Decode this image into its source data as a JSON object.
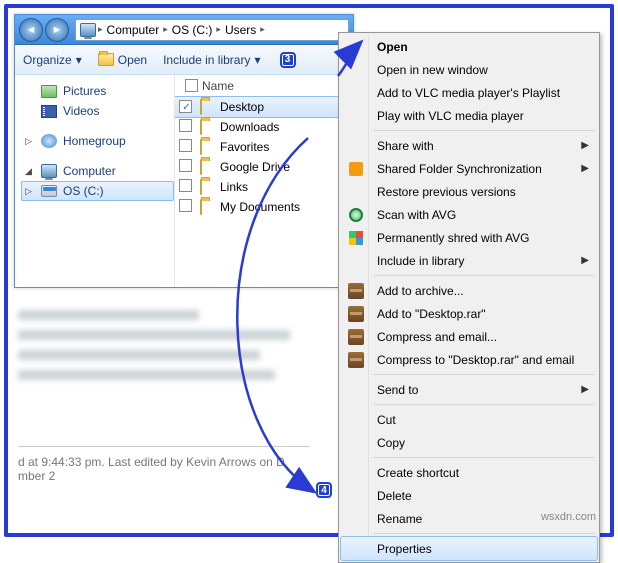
{
  "breadcrumb": {
    "root": "Computer",
    "drive": "OS (C:)",
    "folder": "Users"
  },
  "toolbar": {
    "organize": "Organize",
    "open": "Open",
    "include": "Include in library"
  },
  "badges": {
    "step3": "3",
    "step4": "4"
  },
  "nav": {
    "pictures": "Pictures",
    "videos": "Videos",
    "homegroup": "Homegroup",
    "computer": "Computer",
    "drive": "OS (C:)"
  },
  "list": {
    "header": "Name",
    "items": [
      {
        "name": "Desktop",
        "selected": true
      },
      {
        "name": "Downloads"
      },
      {
        "name": "Favorites"
      },
      {
        "name": "Google Drive"
      },
      {
        "name": "Links"
      },
      {
        "name": "My Documents"
      }
    ]
  },
  "ctx": {
    "open": "Open",
    "open_new": "Open in new window",
    "vlc_add": "Add to VLC media player's Playlist",
    "vlc_play": "Play with VLC media player",
    "share": "Share with",
    "sync": "Shared Folder Synchronization",
    "restore": "Restore previous versions",
    "avg_scan": "Scan with AVG",
    "avg_shred": "Permanently shred with AVG",
    "include": "Include in library",
    "archive": "Add to archive...",
    "archive_name": "Add to \"Desktop.rar\"",
    "comp_email": "Compress and email...",
    "comp_name_email": "Compress to \"Desktop.rar\" and email",
    "sendto": "Send to",
    "cut": "Cut",
    "copy": "Copy",
    "shortcut": "Create shortcut",
    "delete": "Delete",
    "rename": "Rename",
    "properties": "Properties"
  },
  "caption": "d at 9:44:33 pm. Last edited by Kevin Arrows on D",
  "caption_suffix": "mber 2",
  "watermark": "wsxdn.com"
}
